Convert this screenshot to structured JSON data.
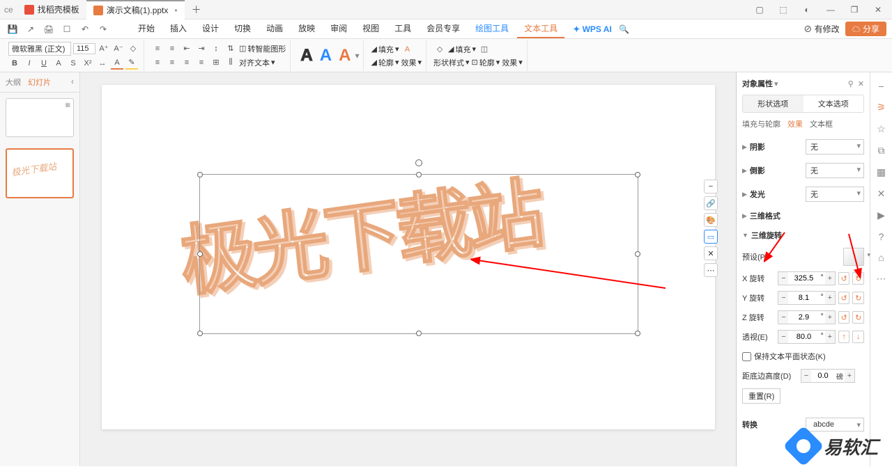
{
  "titlebar": {
    "office_label": "ce",
    "tab1": "找稻壳模板",
    "tab2": "演示文稿(1).pptx",
    "add": "＋"
  },
  "win": {
    "box": "▢",
    "cube": "⬚",
    "avatar": "◐",
    "min": "—",
    "restore": "❐",
    "close": "✕"
  },
  "menubar": {
    "save_mod": "有修改",
    "share": "分享",
    "tabs": {
      "start": "开始",
      "insert": "插入",
      "design": "设计",
      "transition": "切换",
      "anim": "动画",
      "show": "放映",
      "review": "审阅",
      "view": "视图",
      "tools": "工具",
      "member": "会员专享",
      "drawing": "绘图工具",
      "text": "文本工具"
    },
    "wps_ai": "WPS AI"
  },
  "ribbon": {
    "font_name": "微软雅黑 (正文)",
    "font_size": "115",
    "convert_smart": "转智能图形",
    "fill": "填充",
    "outline": "轮廓",
    "effect": "效果",
    "shape_style": "形状样式",
    "outline2": "轮廓",
    "effect2": "效果",
    "text_effect": "对齐文本"
  },
  "left": {
    "outline": "大纲",
    "slide": "幻灯片",
    "thumb_text": "极光下载站"
  },
  "canvas": {
    "main_text": "极光下载站"
  },
  "right": {
    "title": "对象属性",
    "shape_opt": "形状选项",
    "text_opt": "文本选项",
    "fill_outline": "填充与轮廓",
    "effect": "效果",
    "textbox": "文本框",
    "shadow": "阴影",
    "reflection": "倒影",
    "glow": "发光",
    "none": "无",
    "format3d": "三维格式",
    "rotate3d": "三维旋转",
    "preset": "预设(P)",
    "xrot": "X 旋转",
    "yrot": "Y 旋转",
    "zrot": "Z 旋转",
    "persp": "透视(E)",
    "xval": "325.5",
    "yval": "8.1",
    "zval": "2.9",
    "pval": "80.0",
    "deg": "°",
    "keep_flat": "保持文本平面状态(K)",
    "dist": "距底边高度(D)",
    "dist_val": "0.0",
    "dist_unit": "磅",
    "reset": "重置(R)",
    "transform": "转换",
    "abcde": "abcde"
  },
  "watermark": "易软汇"
}
